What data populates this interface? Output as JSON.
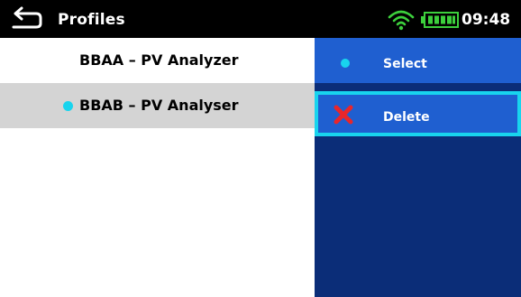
{
  "header": {
    "title": "Profiles",
    "back_icon": "back-arrow-icon",
    "wifi_icon": "wifi-icon",
    "battery_icon": "battery-icon",
    "time": "09:48"
  },
  "profiles": {
    "items": [
      {
        "label": "BBAA – PV Analyzer",
        "active": false
      },
      {
        "label": "BBAB – PV Analyser",
        "active": true
      }
    ]
  },
  "menu": {
    "items": [
      {
        "label": "Select",
        "icon": "bullet-icon",
        "focused": false
      },
      {
        "label": "Delete",
        "icon": "delete-x-icon",
        "focused": true
      }
    ]
  },
  "colors": {
    "header_bg": "#000000",
    "menu_bg": "#0b2d78",
    "menu_item_bg": "#1f5fd0",
    "accent": "#18d4ee",
    "selected_row_bg": "#d4d4d4",
    "delete_red": "#e8262b",
    "battery_green": "#3ccf3c"
  }
}
